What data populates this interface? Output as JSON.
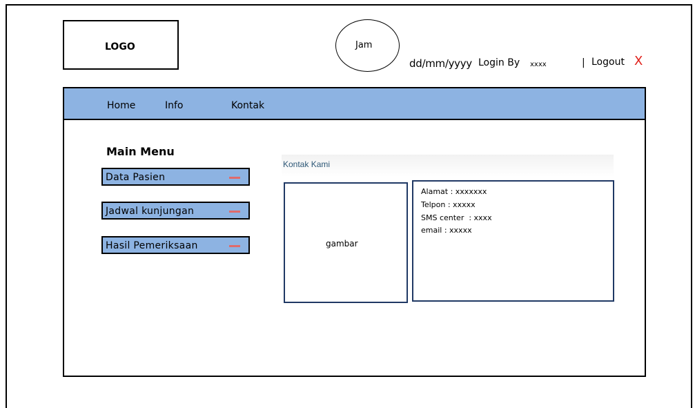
{
  "header": {
    "logo": "LOGO",
    "clock": "Jam",
    "date": "dd/mm/yyyy",
    "login_by_label": "Login By",
    "login_user": "xxxx",
    "logout_separator": "|",
    "logout_label": "Logout",
    "logout_icon": "X"
  },
  "nav": {
    "items": [
      {
        "label": "Home"
      },
      {
        "label": "Info"
      },
      {
        "label": "Kontak"
      }
    ]
  },
  "sidebar": {
    "title": "Main Menu",
    "items": [
      {
        "label": "Data Pasien"
      },
      {
        "label": "Jadwal kunjungan"
      },
      {
        "label": "Hasil Pemeriksaan"
      }
    ]
  },
  "contact": {
    "heading": "Kontak Kami",
    "image_label": "gambar",
    "lines": [
      "Alamat : xxxxxxx",
      "Telpon : xxxxx",
      "SMS center  : xxxx",
      "email : xxxxx"
    ]
  },
  "colors": {
    "nav_bg": "#8db3e2",
    "accent_red": "#e0201a",
    "box_border": "#1f3864"
  }
}
